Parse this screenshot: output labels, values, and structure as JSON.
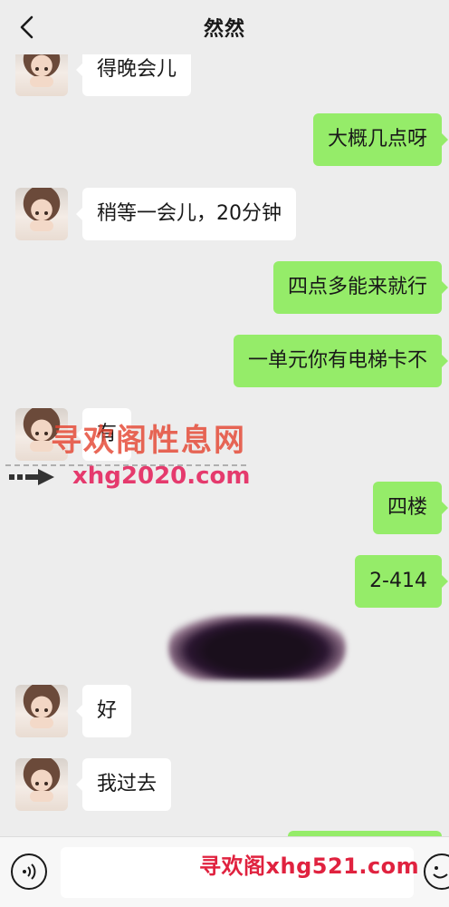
{
  "header": {
    "title": "然然"
  },
  "messages": [
    {
      "dir": "in",
      "text": "得晚会儿"
    },
    {
      "dir": "out",
      "text": "大概几点呀"
    },
    {
      "dir": "in",
      "text": "稍等一会儿，20分钟"
    },
    {
      "dir": "out",
      "text": "四点多能来就行"
    },
    {
      "dir": "out",
      "text": "一单元你有电梯卡不"
    },
    {
      "dir": "in",
      "text": "有"
    },
    {
      "dir": "out",
      "text": "四楼"
    },
    {
      "dir": "out",
      "text": "2-414"
    },
    {
      "dir": "in",
      "text": "好"
    },
    {
      "dir": "in",
      "text": "我过去"
    }
  ],
  "watermarks": {
    "top_cn": "寻欢阁性息网",
    "top_url": "xhg2020.com",
    "bottom": "寻欢阁xhg521.com"
  },
  "input": {
    "placeholder": ""
  }
}
